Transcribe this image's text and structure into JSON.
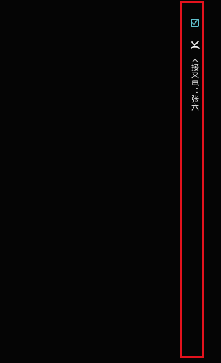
{
  "notification": {
    "icons": {
      "task": "check-square-icon",
      "missed_call": "missed-call-icon"
    },
    "message": "未接来电：张六",
    "colors": {
      "background": "#050505",
      "frame": "#e3121d",
      "icon": "#62c2cf",
      "text": "#f1f1f1"
    }
  }
}
